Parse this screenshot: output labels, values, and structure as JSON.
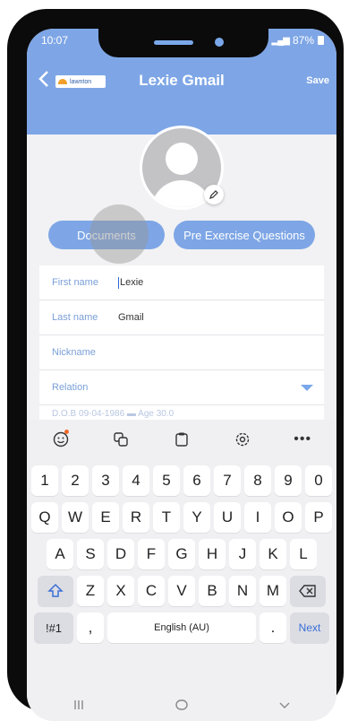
{
  "status_bar": {
    "time": "10:07",
    "battery": "87%"
  },
  "header": {
    "title": "Lexie Gmail",
    "save_label": "Save",
    "logo_text": "lawnton"
  },
  "buttons": {
    "documents": "Documents",
    "pre_exercise": "Pre Exercise Questions"
  },
  "form": {
    "first_name": {
      "label": "First name",
      "value": "Lexie"
    },
    "last_name": {
      "label": "Last name",
      "value": "Gmail"
    },
    "nickname": {
      "label": "Nickname"
    },
    "relation": {
      "label": "Relation"
    },
    "partial_row": "D.O.B    09-04-1986                 ▬     Age    30.0"
  },
  "keyboard": {
    "numbers": [
      "1",
      "2",
      "3",
      "4",
      "5",
      "6",
      "7",
      "8",
      "9",
      "0"
    ],
    "row1": [
      "Q",
      "W",
      "E",
      "R",
      "T",
      "Y",
      "U",
      "I",
      "O",
      "P"
    ],
    "row2": [
      "A",
      "S",
      "D",
      "F",
      "G",
      "H",
      "J",
      "K",
      "L"
    ],
    "row3": [
      "Z",
      "X",
      "C",
      "V",
      "B",
      "N",
      "M"
    ],
    "sym_label": "!#1",
    "comma": ",",
    "space_label": "English (AU)",
    "period": ".",
    "next_label": "Next"
  },
  "colors": {
    "header_blue": "#7ea6e6",
    "label_blue": "#7a9fd8",
    "accent": "#3a6fd6"
  },
  "icons": [
    "back-icon",
    "edit-icon",
    "emoji-icon",
    "translate-icon",
    "clipboard-icon",
    "settings-icon",
    "shift-icon",
    "backspace-icon"
  ]
}
